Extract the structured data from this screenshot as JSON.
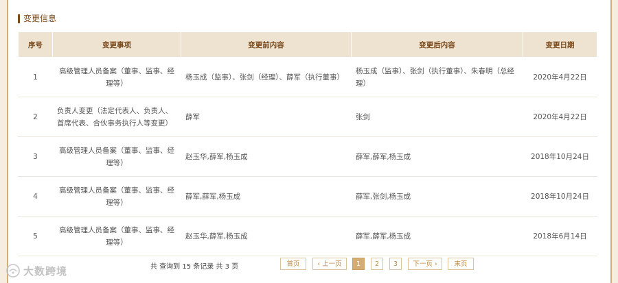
{
  "section": {
    "title": "变更信息"
  },
  "table": {
    "headers": [
      "序号",
      "变更事项",
      "变更前内容",
      "变更后内容",
      "变更日期"
    ],
    "rows": [
      {
        "index": "1",
        "item": "高级管理人员备案（董事、监事、经理等）",
        "before": "杨玉成（监事）、张剑（经理）、薛军（执行董事）",
        "after": "杨玉成（监事）、张剑（执行董事）、朱春明（总经理）",
        "date": "2020年4月22日"
      },
      {
        "index": "2",
        "item": "负责人变更（法定代表人、负责人、首席代表、合伙事务执行人等变更）",
        "before": "薛军",
        "after": "张剑",
        "date": "2020年4月22日"
      },
      {
        "index": "3",
        "item": "高级管理人员备案（董事、监事、经理等）",
        "before": "赵玉华,薛军,杨玉成",
        "after": "薛军,薛军,杨玉成",
        "date": "2018年10月24日"
      },
      {
        "index": "4",
        "item": "高级管理人员备案（董事、监事、经理等）",
        "before": "薛军,薛军,杨玉成",
        "after": "薛军,张剑,杨玉成",
        "date": "2018年10月24日"
      },
      {
        "index": "5",
        "item": "高级管理人员备案（董事、监事、经理等）",
        "before": "赵玉华,薛军,杨玉成",
        "after": "薛军,薛军,杨玉成",
        "date": "2018年6月14日"
      }
    ]
  },
  "pagination": {
    "info": "共 查询到 15 条记录 共 3 页",
    "first": "首页",
    "prev": "‹ 上一页",
    "pages": [
      "1",
      "2",
      "3"
    ],
    "current": "1",
    "next": "下一页 ›",
    "last": "末页"
  },
  "watermark": {
    "text": "大数跨境",
    "icon": "brand-logo-icon"
  },
  "colors": {
    "accent": "#7b4a1c",
    "header_bg": "#eee3d0",
    "border": "#d2ae76",
    "pager_active": "#d2ae76"
  }
}
